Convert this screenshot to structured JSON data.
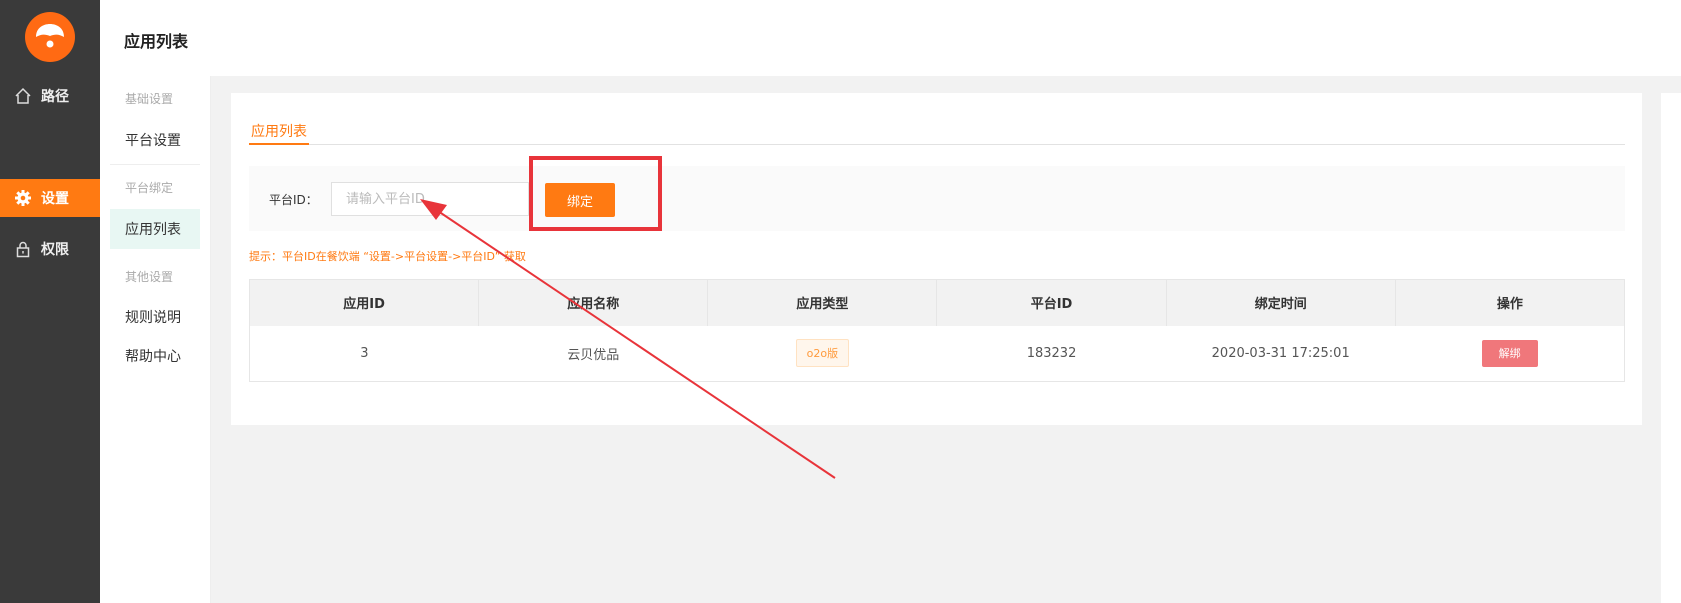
{
  "nav": {
    "items": [
      {
        "label": "路径",
        "icon": "home-icon"
      },
      {
        "label": "设置",
        "icon": "gear-icon",
        "active": true
      },
      {
        "label": "权限",
        "icon": "lock-icon"
      }
    ]
  },
  "header": {
    "title": "应用列表"
  },
  "subnav": {
    "groups": [
      "基础设置",
      "平台绑定",
      "其他设置"
    ],
    "items": {
      "platform_settings": "平台设置",
      "app_list": "应用列表",
      "rules": "规则说明",
      "help": "帮助中心"
    }
  },
  "main": {
    "tab": "应用列表",
    "filter": {
      "label": "平台ID：",
      "placeholder": "请输入平台ID",
      "value": "",
      "bind_button": "绑定"
    },
    "hint": "提示：平台ID在餐饮端 “设置->平台设置->平台ID” 获取",
    "table": {
      "headers": [
        "应用ID",
        "应用名称",
        "应用类型",
        "平台ID",
        "绑定时间",
        "操作"
      ],
      "rows": [
        {
          "app_id": "3",
          "app_name": "云贝优品",
          "app_type": "o2o版",
          "platform_id": "183232",
          "bind_time": "2020-03-31 17:25:01",
          "action": "解绑"
        }
      ]
    }
  },
  "colors": {
    "accent": "#ff7a12",
    "nav_bg": "#3a3a3a",
    "danger": "#f0777b",
    "annotation": "#e8343a"
  }
}
